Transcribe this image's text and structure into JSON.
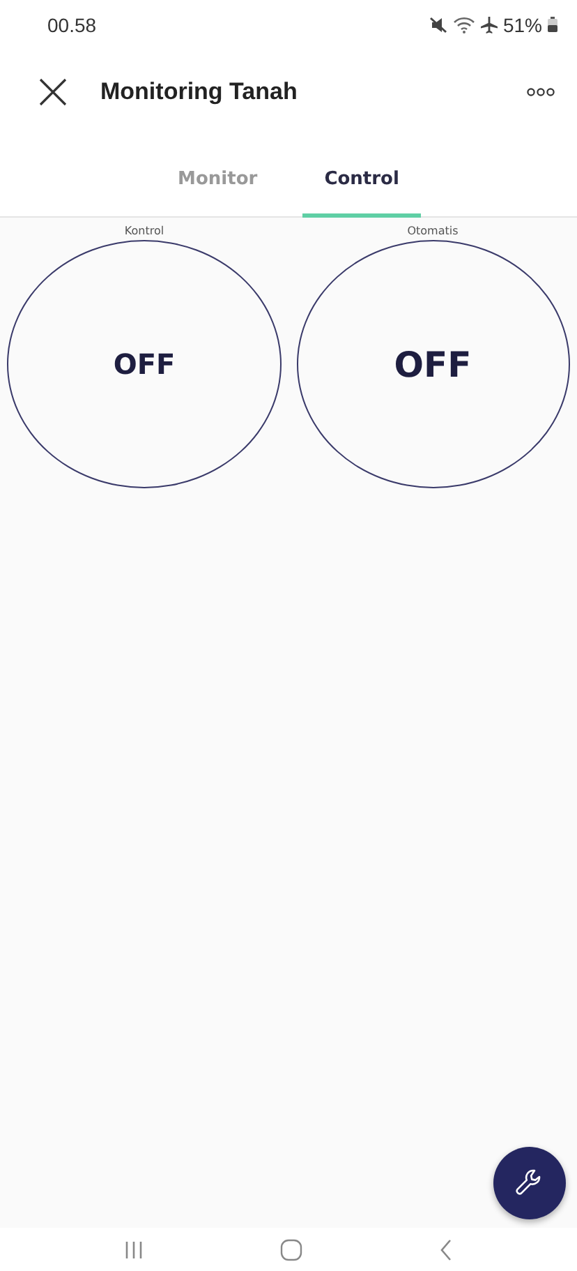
{
  "status_bar": {
    "time": "00.58",
    "battery": "51%"
  },
  "header": {
    "title": "Monitoring Tanah"
  },
  "tabs": [
    {
      "label": "Monitor",
      "selected": false
    },
    {
      "label": "Control",
      "selected": true
    }
  ],
  "widgets": [
    {
      "label": "Kontrol",
      "value": "OFF",
      "on": false
    },
    {
      "label": "Otomatis",
      "value": "OFF",
      "on": false
    }
  ]
}
